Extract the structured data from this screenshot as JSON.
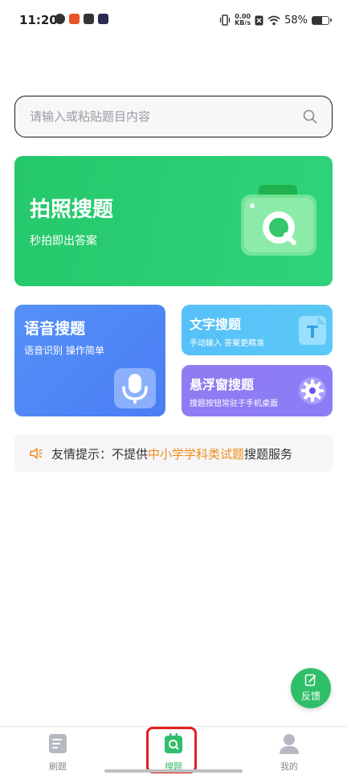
{
  "status_bar": {
    "time": "11:20",
    "net_speed_value": "0.00",
    "net_speed_unit": "KB/s",
    "battery_percent": "58%",
    "battery_level": 0.58
  },
  "search": {
    "placeholder": "请输入或粘贴题目内容",
    "icon": "search-icon"
  },
  "photo_search": {
    "title": "拍照搜题",
    "subtitle": "秒拍即出答案",
    "icon": "camera-icon"
  },
  "voice_search": {
    "title": "语音搜题",
    "subtitle": "语音识别 操作简单",
    "icon": "microphone-icon"
  },
  "text_search": {
    "title": "文字搜题",
    "subtitle": "手动输入 答案更精准",
    "icon": "text-t-icon"
  },
  "float_search": {
    "title": "悬浮窗搜题",
    "subtitle": "搜题按钮常驻于手机桌面",
    "icon": "gear-icon"
  },
  "tip": {
    "prefix": "友情提示：不提供",
    "highlight": "中小学学科类试题",
    "suffix": "搜题服务"
  },
  "feedback": {
    "label": "反馈"
  },
  "bottom_nav": {
    "items": [
      {
        "label": "刷题",
        "icon": "document-icon",
        "active": false
      },
      {
        "label": "搜题",
        "icon": "search-tab-icon",
        "active": true
      },
      {
        "label": "我的",
        "icon": "profile-icon",
        "active": false
      }
    ]
  },
  "colors": {
    "accent_green": "#2fbf6a",
    "photo_card": "#25c86a",
    "voice_card": "#4a7ef5",
    "text_card": "#56c0f8",
    "float_card": "#8b7df5",
    "tip_highlight": "#f08a1c",
    "highlight_box": "#e02020"
  }
}
